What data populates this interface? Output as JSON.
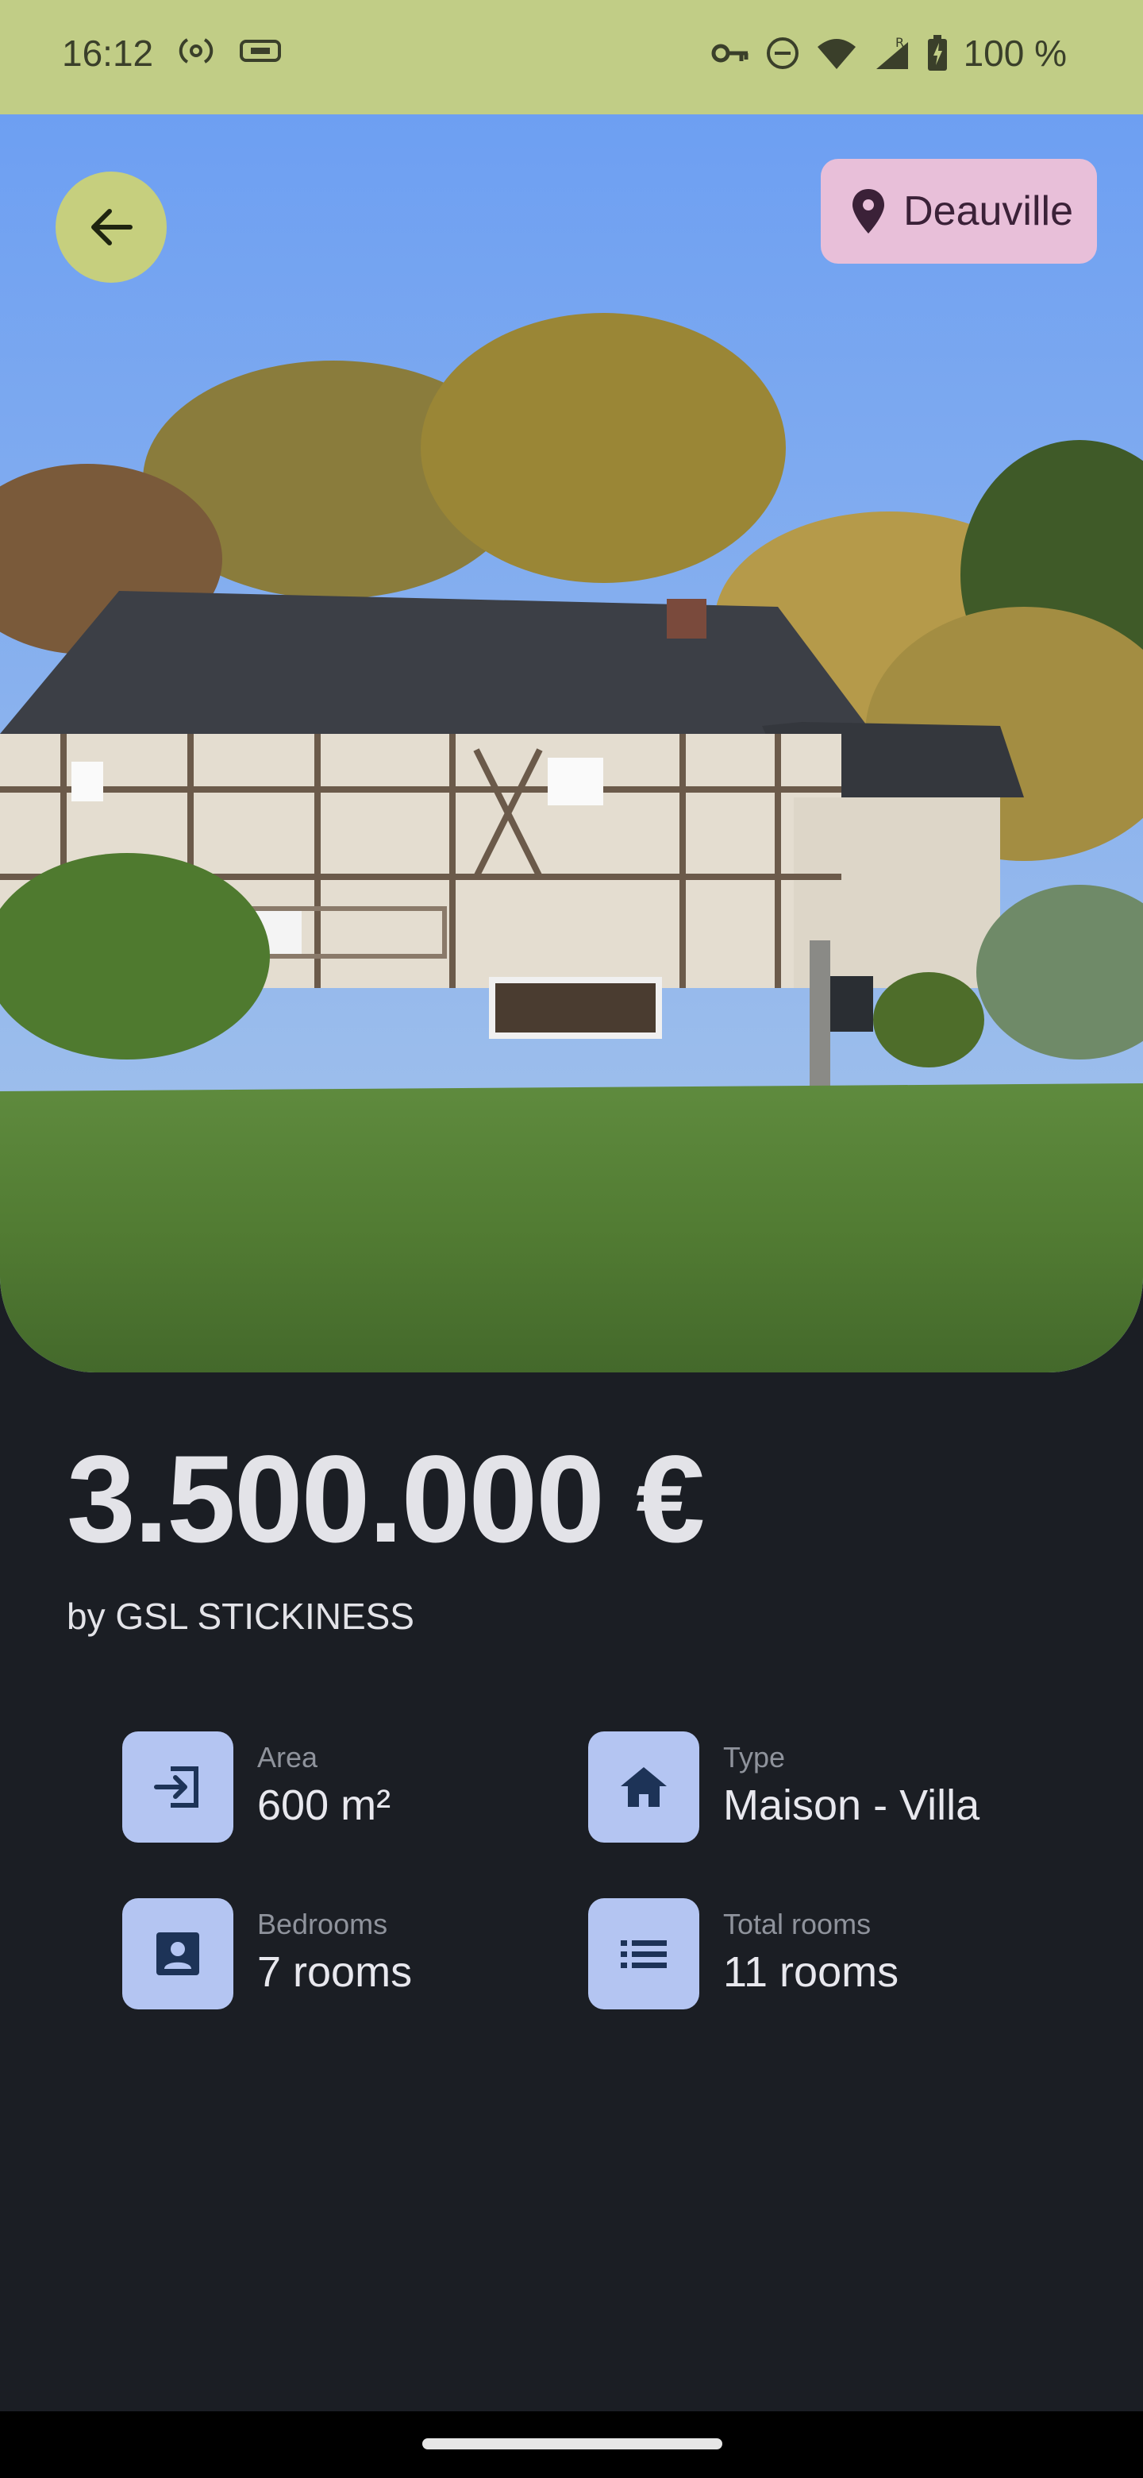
{
  "status_bar": {
    "time": "16:12",
    "battery": "100 %"
  },
  "listing": {
    "location": "Deauville",
    "price": "3.500.000 €",
    "seller": "by GSL STICKINESS",
    "features": [
      {
        "label": "Area",
        "value": "600 m²",
        "icon": "enter-icon"
      },
      {
        "label": "Type",
        "value": "Maison - Villa",
        "icon": "home-icon"
      },
      {
        "label": "Bedrooms",
        "value": "7 rooms",
        "icon": "person-box-icon"
      },
      {
        "label": "Total rooms",
        "value": "11 rooms",
        "icon": "list-icon"
      }
    ]
  },
  "colors": {
    "status_bar": "#c1cd86",
    "background": "#1b1e24",
    "back_button": "#c6cf7e",
    "location_chip": "#e8bfd9",
    "feature_icon_bg": "#b4c5f2"
  }
}
